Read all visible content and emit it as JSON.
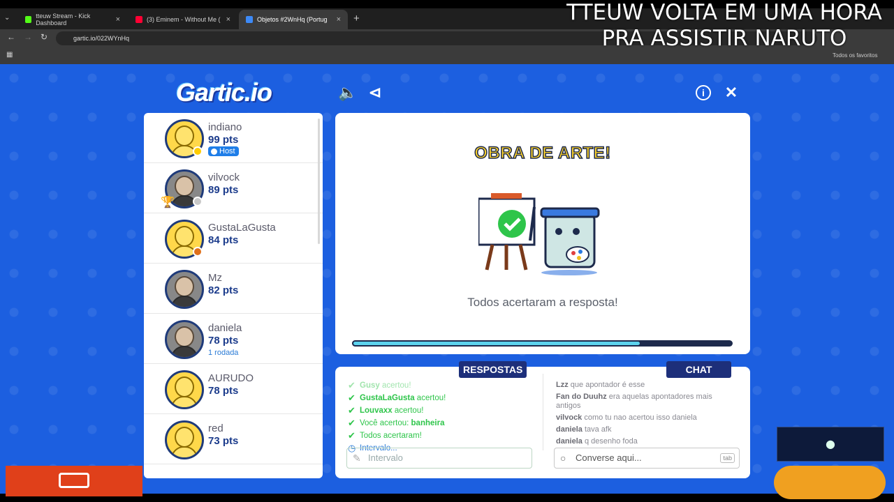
{
  "browser": {
    "tabs": [
      {
        "label": "tteuw Stream - Kick Dashboard",
        "color": "#53fc18"
      },
      {
        "label": "(3) Eminem - Without Me (",
        "color": "#ff0033"
      },
      {
        "label": "Objetos #2WnHq (Portug",
        "color": "#3d8af7"
      }
    ],
    "url": "gartic.io/022WYnHq",
    "bookmarks_label": "Todos os favoritos"
  },
  "overlay": {
    "line1": "TTEUW VOLTA EM UMA HORA",
    "line2": "PRA ASSISTIR NARUTO"
  },
  "game": {
    "logo": "Gartic.io",
    "players": [
      {
        "name": "indiano",
        "pts": "99 pts",
        "badge": "Host",
        "status": "#ffcc00",
        "avatar": "cartoon"
      },
      {
        "name": "vilvock",
        "pts": "89 pts",
        "status": "#c8c8c8",
        "avatar": "photo",
        "trophy": "1"
      },
      {
        "name": "GustaLaGusta",
        "pts": "84 pts",
        "status": "#e0701a",
        "avatar": "cartoon"
      },
      {
        "name": "Mz",
        "pts": "82 pts",
        "avatar": "photo"
      },
      {
        "name": "daniela",
        "pts": "78 pts",
        "sub": "1 rodada",
        "avatar": "photo"
      },
      {
        "name": "AURUDO",
        "pts": "78 pts",
        "avatar": "cartoon"
      },
      {
        "name": "red",
        "pts": "73 pts",
        "avatar": "cartoon"
      }
    ],
    "stage": {
      "title": "OBRA DE ARTE!",
      "message": "Todos acertaram a resposta!",
      "progress": 0.76
    },
    "answers_tab": "RESPOSTAS",
    "chat_tab": "CHAT",
    "answers": [
      {
        "who": "Gusy",
        "text": " acertou!"
      },
      {
        "who": "GustaLaGusta",
        "text": " acertou!"
      },
      {
        "who": "Louvaxx",
        "text": " acertou!"
      },
      {
        "who": "Você acertou: ",
        "text": "banheira",
        "swap": true
      },
      {
        "who": "",
        "text": "Todos acertaram!"
      },
      {
        "who": "",
        "text": "Intervalo...",
        "interval": true
      }
    ],
    "chat": [
      {
        "who": "Lzz",
        "text": " que apontador é esse"
      },
      {
        "who": "Fan do Duuhz",
        "text": " era aquelas apontadores mais antigos"
      },
      {
        "who": "vilvock",
        "text": " como tu nao acertou isso daniela"
      },
      {
        "who": "daniela",
        "text": " tava afk"
      },
      {
        "who": "daniela",
        "text": " q desenho foda"
      }
    ],
    "answer_placeholder": "Intervalo",
    "chat_placeholder": "Converse aqui...",
    "tab_key": "tab"
  }
}
